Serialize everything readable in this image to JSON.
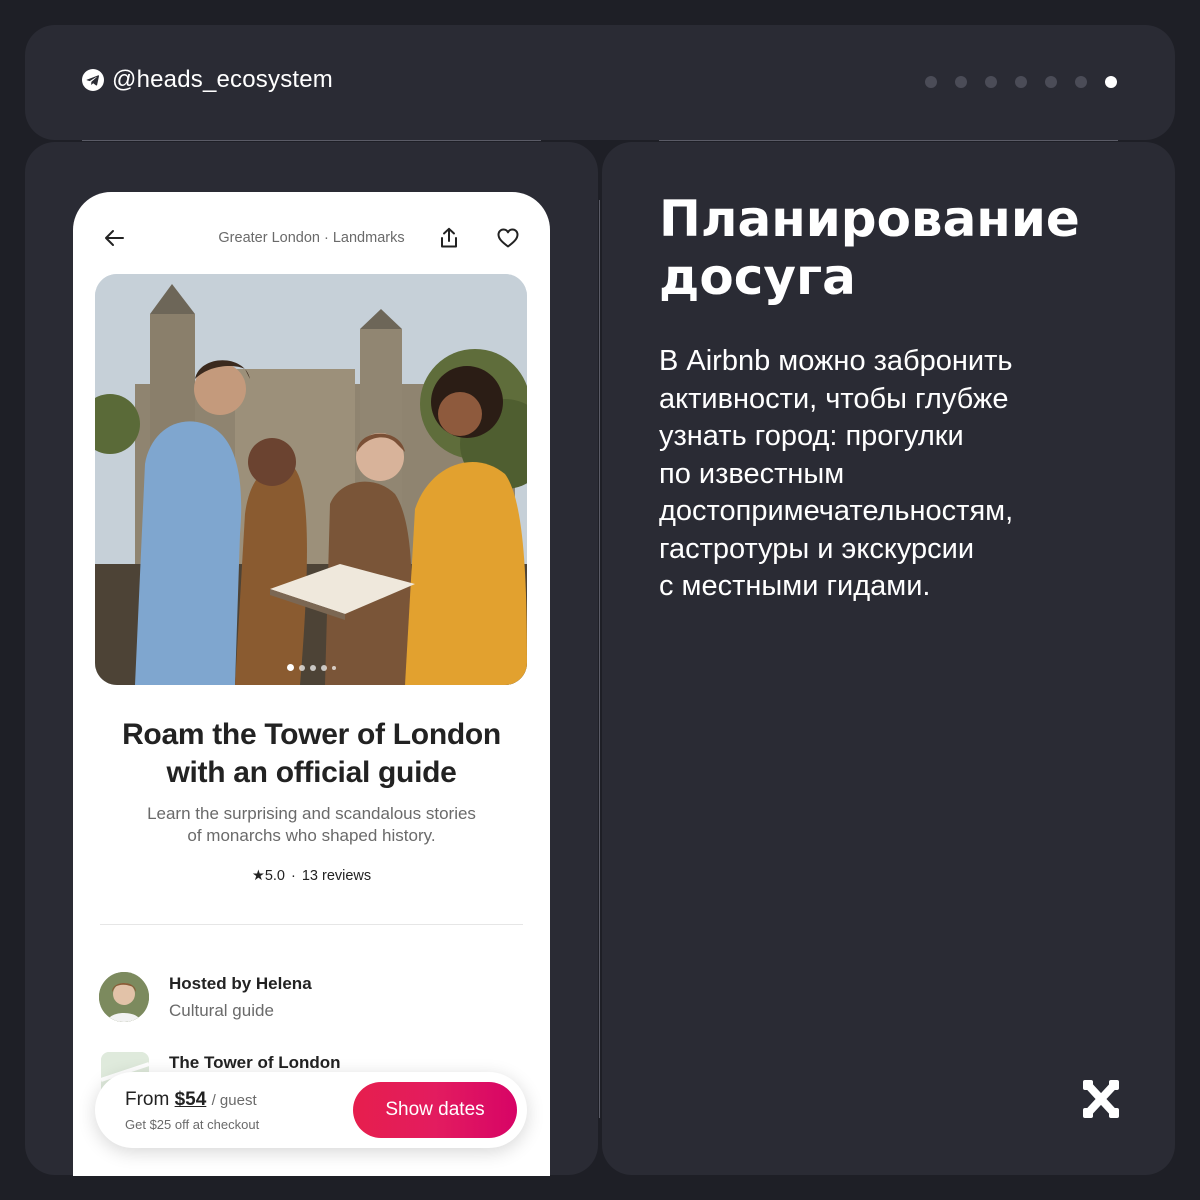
{
  "header": {
    "handle": "@heads_ecosystem",
    "pagination": {
      "total": 7,
      "active_index": 6
    }
  },
  "phone": {
    "breadcrumb": "Greater London · Landmarks",
    "photo_carousel": {
      "total": 5,
      "active_index": 0
    },
    "title_line1": "Roam the Tower of London",
    "title_line2": "with an official guide",
    "subtitle_line1": "Learn the surprising and scandalous stories",
    "subtitle_line2": "of monarchs who shaped history.",
    "rating": "★5.0",
    "rating_separator": "·",
    "reviews": "13 reviews",
    "host_name": "Hosted by Helena",
    "host_role": "Cultural guide",
    "place_name": "The Tower of London",
    "booking": {
      "from_label": "From",
      "price": "$54",
      "unit": "/ guest",
      "discount": "Get $25 off at checkout",
      "button_label": "Show dates"
    }
  },
  "article": {
    "heading_line1": "Планирование",
    "heading_line2": "досуга",
    "body_lines": [
      "В Airbnb можно забронить",
      "активности, чтобы глубже",
      "узнать город: прогулки",
      "по известным",
      "достопримечательностям,",
      "гастротуры и экскурсии",
      "с местными гидами."
    ]
  },
  "colors": {
    "background": "#1e1f26",
    "panel": "#2a2b34",
    "accent": "#e31c5f"
  }
}
